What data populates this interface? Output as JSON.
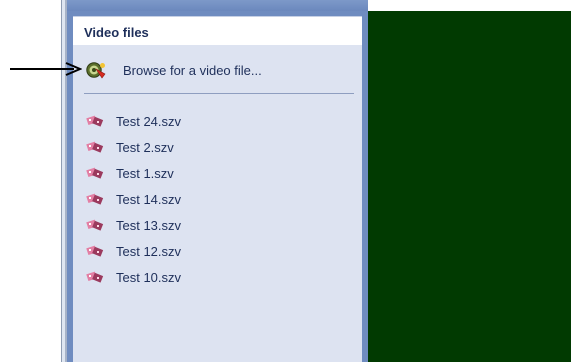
{
  "panel": {
    "title": "Video files",
    "browse": {
      "label": "Browse for a video file...",
      "icon": "browse-video-icon"
    },
    "files": [
      {
        "label": "Test 24.szv",
        "icon": "video-file-icon"
      },
      {
        "label": "Test 2.szv",
        "icon": "video-file-icon"
      },
      {
        "label": "Test 1.szv",
        "icon": "video-file-icon"
      },
      {
        "label": "Test 14.szv",
        "icon": "video-file-icon"
      },
      {
        "label": "Test 13.szv",
        "icon": "video-file-icon"
      },
      {
        "label": "Test 12.szv",
        "icon": "video-file-icon"
      },
      {
        "label": "Test 10.szv",
        "icon": "video-file-icon"
      }
    ]
  },
  "colors": {
    "pane_blue": "#6f8cc0",
    "panel_bg": "#dde3f1",
    "text": "#1e2f5a",
    "video_bg": "#013a01"
  },
  "annotation": {
    "arrow_icon": "pointer-arrow-icon"
  }
}
